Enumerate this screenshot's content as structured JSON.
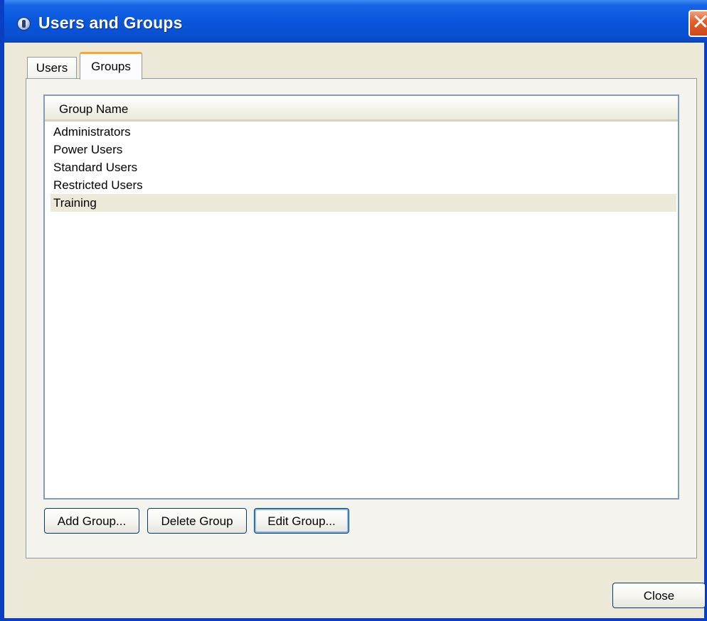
{
  "window": {
    "title": "Users and Groups"
  },
  "tabs": [
    {
      "label": "Users",
      "active": false
    },
    {
      "label": "Groups",
      "active": true
    }
  ],
  "list": {
    "column_header": "Group Name",
    "rows": [
      {
        "label": "Administrators",
        "selected": false
      },
      {
        "label": "Power Users",
        "selected": false
      },
      {
        "label": "Standard Users",
        "selected": false
      },
      {
        "label": "Restricted Users",
        "selected": false
      },
      {
        "label": "Training",
        "selected": true
      }
    ]
  },
  "buttons": {
    "add_group": "Add Group...",
    "delete_group": "Delete Group",
    "edit_group": "Edit Group...",
    "close": "Close"
  },
  "icons": {
    "app_icon": "app-icon",
    "close_window": "close-icon"
  },
  "colors": {
    "titlebar": "#0a4fd0",
    "selection": "#ece9d8",
    "active_tab_accent": "#f6a72c"
  }
}
